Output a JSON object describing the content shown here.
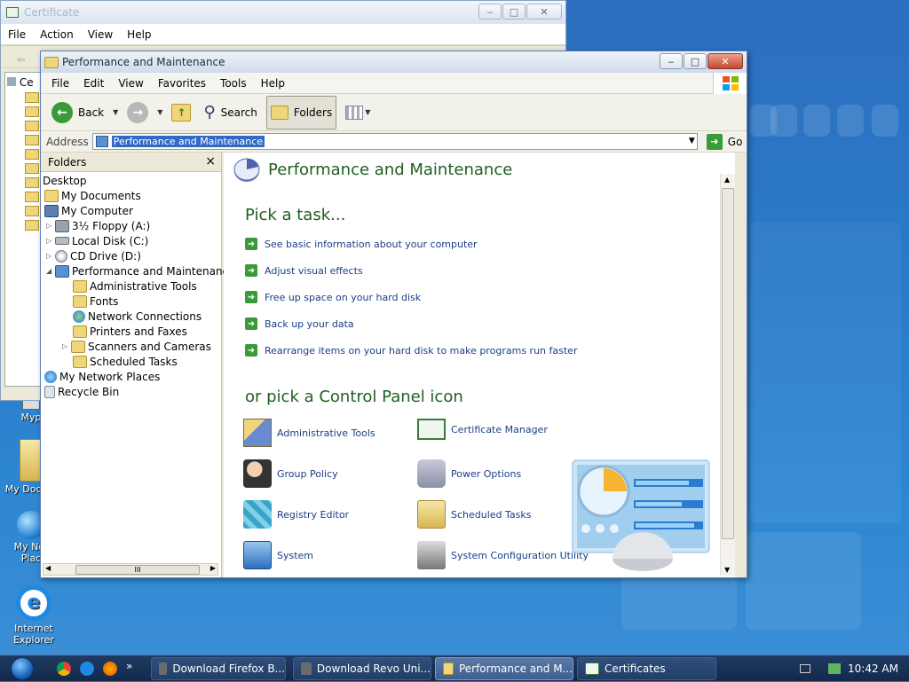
{
  "colors": {
    "desktop": "#2a7ac8",
    "heading_green": "#215e21",
    "link_blue": "#1b3f84",
    "selection": "#316ac5",
    "taskbar": "#1f3b63"
  },
  "bg_window": {
    "title": "Certificate",
    "menu": [
      "File",
      "Action",
      "View",
      "Help"
    ],
    "tree_root": "Ce"
  },
  "desktop_icons": [
    {
      "label": "Myp",
      "icon": "computer-icon"
    },
    {
      "label": "My Docum",
      "icon": "folder-icon"
    },
    {
      "label": "My Net Plac",
      "icon": "network-places-icon"
    },
    {
      "label": "Internet Explorer",
      "icon": "ie-icon"
    }
  ],
  "window": {
    "title": "Performance and Maintenance",
    "menu": [
      "File",
      "Edit",
      "View",
      "Favorites",
      "Tools",
      "Help"
    ],
    "toolbar": {
      "back": "Back",
      "search": "Search",
      "folders": "Folders"
    },
    "address": {
      "label": "Address",
      "value": "Performance and Maintenance",
      "go": "Go"
    }
  },
  "folders_pane": {
    "header": "Folders",
    "close": "×",
    "scroll_thumb": "III",
    "items": [
      {
        "label": "Desktop"
      },
      {
        "label": "My Documents"
      },
      {
        "label": "My Computer"
      },
      {
        "label": "3½ Floppy (A:)"
      },
      {
        "label": "Local Disk (C:)"
      },
      {
        "label": "CD Drive (D:)"
      },
      {
        "label": "Performance and Maintenance"
      },
      {
        "label": "Administrative Tools"
      },
      {
        "label": "Fonts"
      },
      {
        "label": "Network Connections"
      },
      {
        "label": "Printers and Faxes"
      },
      {
        "label": "Scanners and Cameras"
      },
      {
        "label": "Scheduled Tasks"
      },
      {
        "label": "My Network Places"
      },
      {
        "label": "Recycle Bin"
      }
    ]
  },
  "content": {
    "title": "Performance and Maintenance",
    "pick_task": "Pick a task...",
    "tasks": [
      "See basic information about your computer",
      "Adjust visual effects",
      "Free up space on your hard disk",
      "Back up your data",
      "Rearrange items on your hard disk to make programs run faster"
    ],
    "pick_icon": "or pick a Control Panel icon",
    "icons": [
      "Administrative Tools",
      "Certificate Manager",
      "Group Policy",
      "Power Options",
      "Registry Editor",
      "Scheduled Tasks",
      "System",
      "System Configuration Utility"
    ]
  },
  "taskbar": {
    "buttons": [
      "Download Firefox B...",
      "Download Revo Uni...",
      "Performance and M...",
      "Certificates"
    ],
    "overflow": "»",
    "clock": "10:42 AM"
  }
}
